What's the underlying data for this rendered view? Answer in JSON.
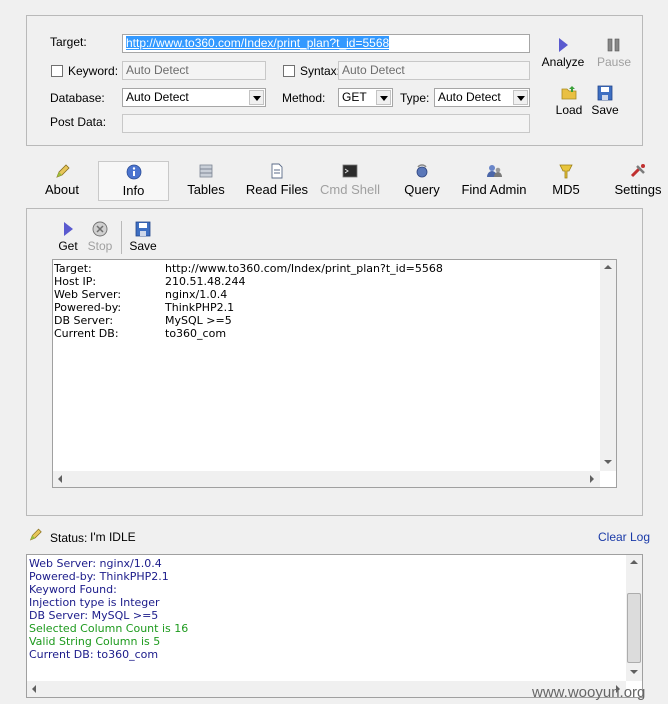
{
  "form": {
    "target_label": "Target:",
    "target_value": "http://www.to360.com/Index/print_plan?t_id=5568",
    "keyword_label": "Keyword:",
    "keyword_placeholder": "Auto Detect",
    "syntax_label": "Syntax:",
    "syntax_placeholder": "Auto Detect",
    "database_label": "Database:",
    "database_value": "Auto Detect",
    "method_label": "Method:",
    "method_value": "GET",
    "type_label": "Type:",
    "type_value": "Auto Detect",
    "postdata_label": "Post Data:",
    "analyze": "Analyze",
    "pause": "Pause",
    "load": "Load",
    "save": "Save"
  },
  "tabs": [
    {
      "label": "About",
      "icon": "pen-icon"
    },
    {
      "label": "Info",
      "icon": "info-icon"
    },
    {
      "label": "Tables",
      "icon": "tables-icon"
    },
    {
      "label": "Read Files",
      "icon": "file-icon"
    },
    {
      "label": "Cmd Shell",
      "icon": "terminal-icon"
    },
    {
      "label": "Query",
      "icon": "query-icon"
    },
    {
      "label": "Find Admin",
      "icon": "admin-icon"
    },
    {
      "label": "MD5",
      "icon": "key-icon"
    },
    {
      "label": "Settings",
      "icon": "tools-icon"
    }
  ],
  "info_toolbar": {
    "get": "Get",
    "stop": "Stop",
    "save": "Save"
  },
  "info_rows": [
    {
      "key": "Target:",
      "value": "http://www.to360.com/Index/print_plan?t_id=5568"
    },
    {
      "key": "Host IP:",
      "value": "210.51.48.244"
    },
    {
      "key": "Web Server:",
      "value": "nginx/1.0.4"
    },
    {
      "key": "Powered-by:",
      "value": "ThinkPHP2.1"
    },
    {
      "key": "DB Server:",
      "value": "MySQL >=5"
    },
    {
      "key": "Current DB:",
      "value": "to360_com"
    }
  ],
  "status": {
    "label": "Status:",
    "value": "I'm IDLE",
    "clear_log": "Clear Log"
  },
  "log_lines": [
    {
      "text": "Web Server: nginx/1.0.4",
      "color": "#1b1b8a"
    },
    {
      "text": "Powered-by: ThinkPHP2.1",
      "color": "#1b1b8a"
    },
    {
      "text": "Keyword Found:",
      "color": "#1b1b8a"
    },
    {
      "text": "Injection type is Integer",
      "color": "#1b1b8a"
    },
    {
      "text": "DB Server: MySQL >=5",
      "color": "#1b1b8a"
    },
    {
      "text": "Selected Column Count is 16",
      "color": "#1d9a1d"
    },
    {
      "text": "Valid String Column is 5",
      "color": "#1d9a1d"
    },
    {
      "text": "Current DB: to360_com",
      "color": "#1b1b8a"
    }
  ],
  "watermark": "www.wooyun.org"
}
